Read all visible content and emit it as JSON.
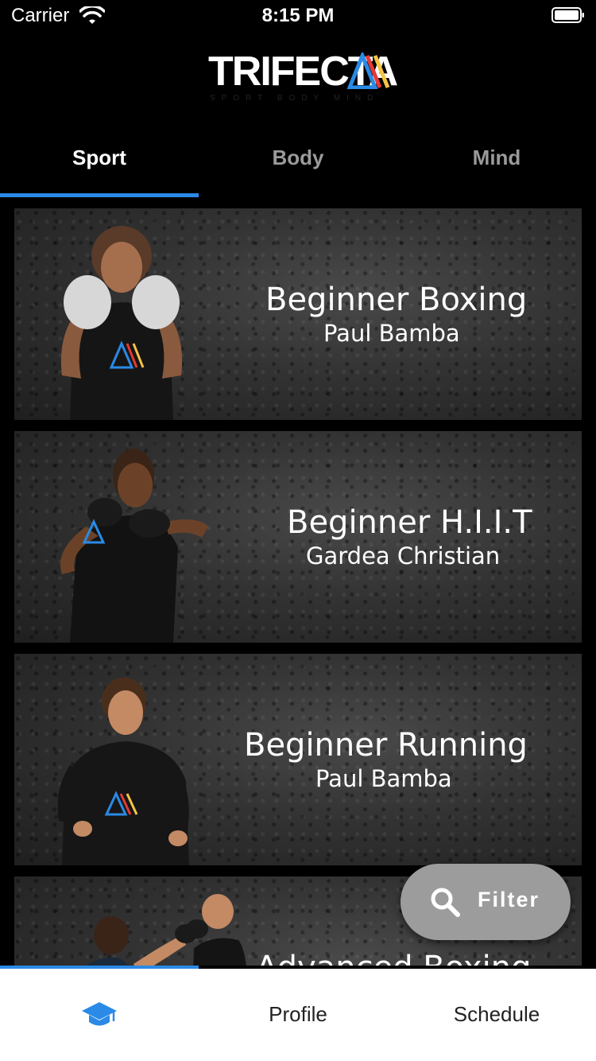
{
  "status_bar": {
    "carrier": "Carrier",
    "time": "8:15 PM"
  },
  "brand": {
    "logo_text": "TRIFECTA",
    "tagline": "SPORT BODY MIND",
    "accent_colors": [
      "#2a8ae6",
      "#e53935",
      "#f6c445"
    ]
  },
  "tabs": [
    {
      "label": "Sport",
      "active": true
    },
    {
      "label": "Body",
      "active": false
    },
    {
      "label": "Mind",
      "active": false
    }
  ],
  "programs": [
    {
      "title": "Beginner Boxing",
      "coach": "Paul Bamba"
    },
    {
      "title": "Beginner H.I.I.T",
      "coach": "Gardea Christian"
    },
    {
      "title": "Beginner Running",
      "coach": "Paul Bamba"
    },
    {
      "title": "Advanced Boxing",
      "coach": ""
    }
  ],
  "filter_button": {
    "label": "Filter",
    "icon": "search-icon"
  },
  "bottom_nav": [
    {
      "label": "",
      "icon": "graduation-cap-icon",
      "active": true
    },
    {
      "label": "Profile",
      "active": false
    },
    {
      "label": "Schedule",
      "active": false
    }
  ],
  "colors": {
    "accent": "#2a8ae6",
    "background": "#000000",
    "filter_bg": "#9c9c9c"
  }
}
